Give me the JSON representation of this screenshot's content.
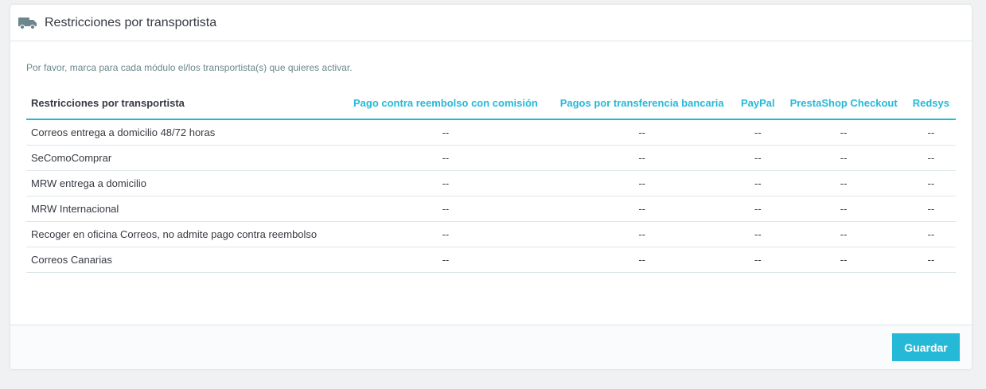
{
  "panel": {
    "title": "Restricciones por transportista",
    "icon": "truck-icon",
    "intro": "Por favor, marca para cada módulo el/los transportista(s) que quieres activar."
  },
  "table": {
    "first_header": "Restricciones por transportista",
    "modules": [
      "Pago contra reembolso con comisión",
      "Pagos por transferencia bancaria",
      "PayPal",
      "PrestaShop Checkout",
      "Redsys"
    ],
    "rows": [
      {
        "carrier": "Correos entrega a domicilio 48/72 horas",
        "cells": [
          "--",
          "--",
          "--",
          "--",
          "--"
        ]
      },
      {
        "carrier": "SeComoComprar",
        "cells": [
          "--",
          "--",
          "--",
          "--",
          "--"
        ]
      },
      {
        "carrier": "MRW entrega a domicilio",
        "cells": [
          "--",
          "--",
          "--",
          "--",
          "--"
        ]
      },
      {
        "carrier": "MRW Internacional",
        "cells": [
          "--",
          "--",
          "--",
          "--",
          "--"
        ]
      },
      {
        "carrier": "Recoger en oficina Correos, no admite pago contra reembolso",
        "cells": [
          "--",
          "--",
          "--",
          "--",
          "--"
        ]
      },
      {
        "carrier": "Correos Canarias",
        "cells": [
          "--",
          "--",
          "--",
          "--",
          "--"
        ]
      }
    ]
  },
  "footer": {
    "save_label": "Guardar"
  },
  "colors": {
    "accent": "#25b9d7",
    "text": "#363a41",
    "muted": "#6c868e",
    "border": "#dbe6e9",
    "background": "#eff1f2"
  }
}
